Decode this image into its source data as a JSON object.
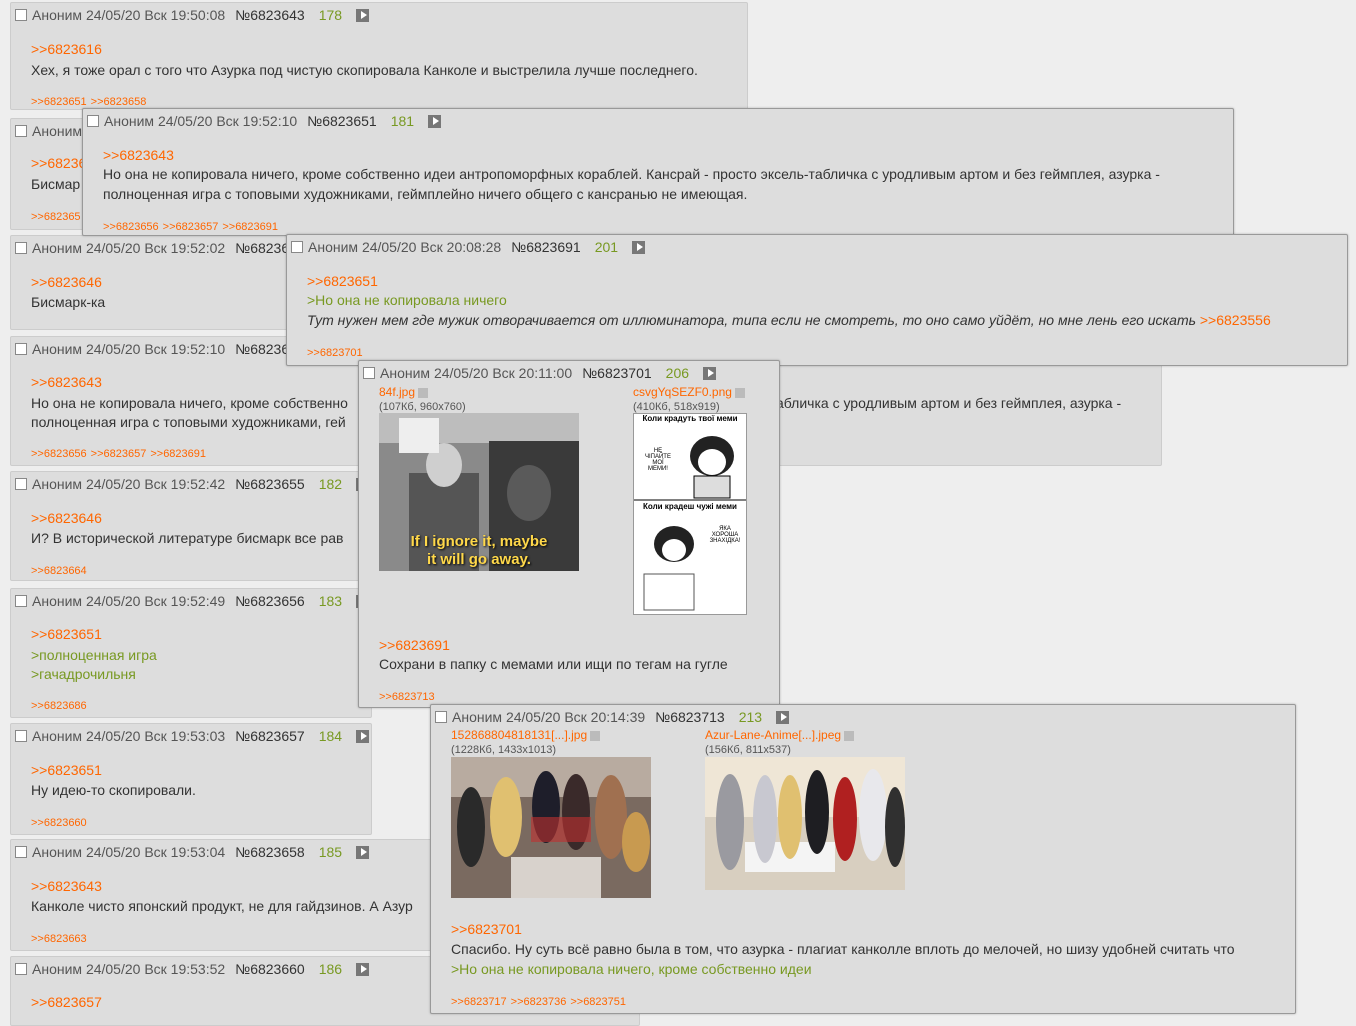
{
  "posts": {
    "p6823643": {
      "author": "Аноним",
      "date": "24/05/20 Вск 19:50:08",
      "num": "№6823643",
      "count": "178",
      "ref": ">>6823616",
      "text": "Хех, я тоже орал с того что Азурка под чистую скопировала Канколе и выстрелила лучше последнего.",
      "replies": [
        ">>6823651",
        ">>6823658"
      ]
    },
    "p6823646": {
      "author": "Аноним",
      "ref": ">>682364",
      "text": "Бисмар",
      "replies": [
        ">>682365"
      ]
    },
    "p6823651": {
      "author": "Аноним",
      "date": "24/05/20 Вск 19:52:10",
      "num": "№6823651",
      "count": "181",
      "ref": ">>6823643",
      "line1": "Но она не копировала ничего, кроме собственно идеи антропоморфных кораблей. Кансрай - просто эксель-табличка с уродливым артом и без геймплея, азурка -",
      "line2": "полноценная игра с топовыми художниками, геймплейно ничего общего с кансранью не имеющая.",
      "replies": [
        ">>6823656",
        ">>6823657",
        ">>6823691"
      ]
    },
    "p6823652": {
      "author": "Аноним",
      "date": "24/05/20 Вск 19:52:02",
      "num": "№682365",
      "ref": ">>6823646",
      "text": "Бисмарк-ка"
    },
    "p6823691": {
      "author": "Аноним",
      "date": "24/05/20 Вск 20:08:28",
      "num": "№6823691",
      "count": "201",
      "ref": ">>6823651",
      "green": ">Но она не копировала ничего",
      "italic": "Тут нужен мем где мужик отворачивается от иллюминатора, типа если не смотреть, то оно само уйдёт, но мне лень его искать",
      "italic_ref": ">>6823556",
      "replies": [
        ">>6823701"
      ]
    },
    "p6823651b": {
      "author": "Аноним",
      "date": "24/05/20 Вск 19:52:10",
      "num": "№682365",
      "ref": ">>6823643",
      "line1": "Но она не копировала ничего, кроме собственно",
      "line1b": "абличка с уродливым артом и без геймплея, азурка -",
      "line2": "полноценная игра с топовыми художниками, гей",
      "replies": [
        ">>6823656",
        ">>6823657",
        ">>6823691"
      ]
    },
    "p6823655": {
      "author": "Аноним",
      "date": "24/05/20 Вск 19:52:42",
      "num": "№6823655",
      "count": "182",
      "ref": ">>6823646",
      "text": "И? В исторической литературе бисмарк все рав",
      "replies": [
        ">>6823664"
      ]
    },
    "p6823656": {
      "author": "Аноним",
      "date": "24/05/20 Вск 19:52:49",
      "num": "№6823656",
      "count": "183",
      "ref": ">>6823651",
      "green1": ">полноценная игра",
      "green2": ">гачадрочильня",
      "replies": [
        ">>6823686"
      ]
    },
    "p6823657": {
      "author": "Аноним",
      "date": "24/05/20 Вск 19:53:03",
      "num": "№6823657",
      "count": "184",
      "ref": ">>6823651",
      "text": "Ну идею-то скопировали.",
      "replies": [
        ">>6823660"
      ]
    },
    "p6823658": {
      "author": "Аноним",
      "date": "24/05/20 Вск 19:53:04",
      "num": "№6823658",
      "count": "185",
      "ref": ">>6823643",
      "text": "Канколе чисто японский продукт, не для гайдзинов. А Азур",
      "replies": [
        ">>6823663"
      ]
    },
    "p6823660": {
      "author": "Аноним",
      "date": "24/05/20 Вск 19:53:52",
      "num": "№6823660",
      "count": "186",
      "ref": ">>6823657"
    },
    "p6823701": {
      "author": "Аноним",
      "date": "24/05/20 Вск 20:11:00",
      "num": "№6823701",
      "count": "206",
      "file1": {
        "name": "84f.jpg",
        "info": "(107Кб, 960x760)",
        "caption1": "If I ignore it, maybe",
        "caption2": "it will go away."
      },
      "file2": {
        "name": "csvgYqSEZF0.png",
        "info": "(410Кб, 518x919)",
        "t1": "Коли крадуть твої меми",
        "t2": "НЕ ЧІПАЙТЕ МОЇ МЕМИ!",
        "t3": "Коли крадеш чужі меми",
        "t4": "ЯКА ХОРОША ЗНАХІДКА!"
      },
      "ref": ">>6823691",
      "text": "Сохрани в папку с мемами или ищи по тегам на гугле",
      "replies": [
        ">>6823713"
      ]
    },
    "p6823713": {
      "author": "Аноним",
      "date": "24/05/20 Вск 20:14:39",
      "num": "№6823713",
      "count": "213",
      "file1": {
        "name": "152868804818131[...].jpg",
        "info": "(1228Кб, 1433x1013)"
      },
      "file2": {
        "name": "Azur-Lane-Anime[...].jpeg",
        "info": "(156Кб, 811x537)"
      },
      "ref": ">>6823701",
      "text": "Спасибо. Ну суть всё равно была в том, что азурка - плагиат канколле вплоть до мелочей, но шизу удобней считать что",
      "green": ">Но она не копировала ничего, кроме собственно идеи",
      "replies": [
        ">>6823717",
        ">>6823736",
        ">>6823751"
      ]
    }
  }
}
